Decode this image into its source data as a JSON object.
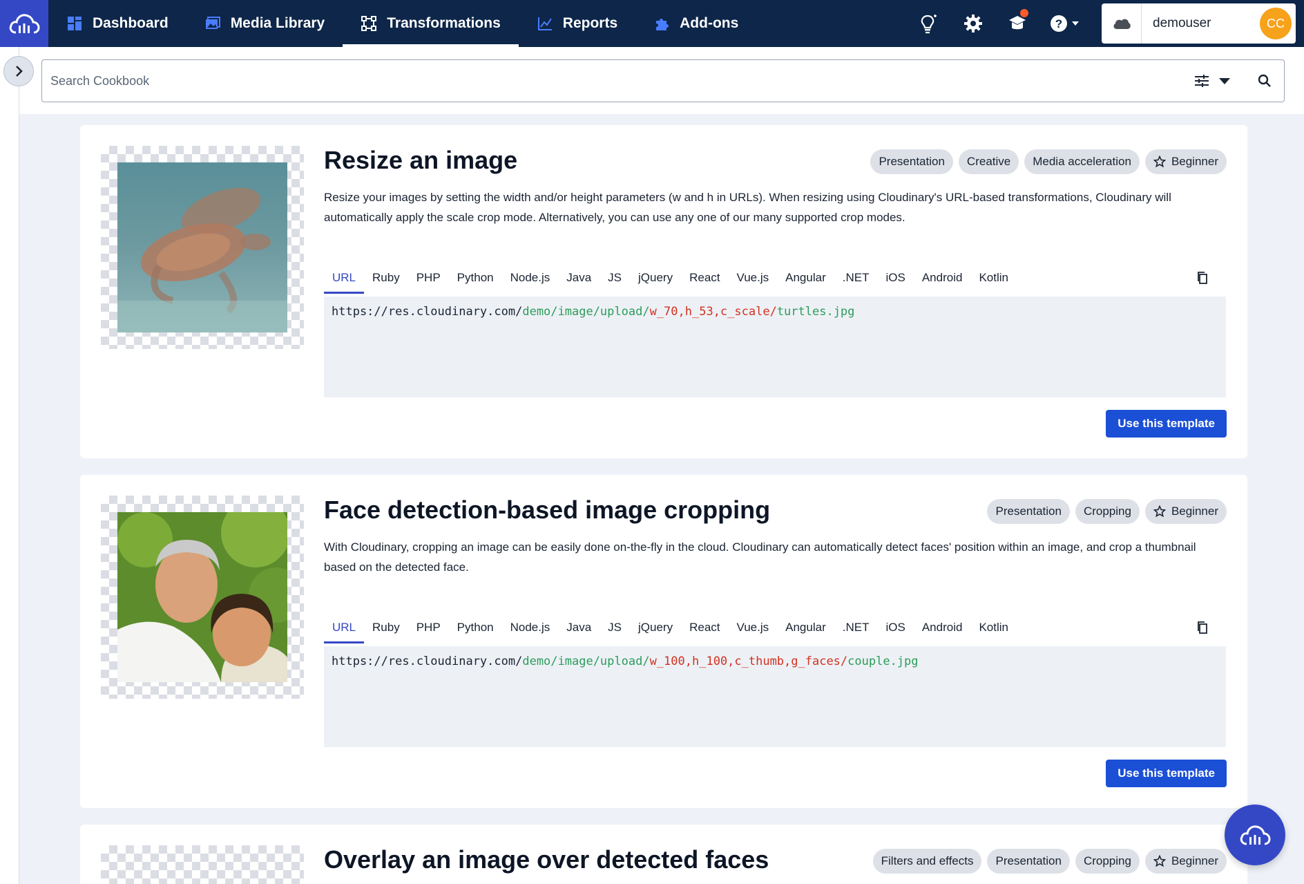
{
  "nav": {
    "items": [
      {
        "label": "Dashboard",
        "icon": "dashboard-icon"
      },
      {
        "label": "Media Library",
        "icon": "media-library-icon"
      },
      {
        "label": "Transformations",
        "icon": "transformations-icon",
        "active": true
      },
      {
        "label": "Reports",
        "icon": "reports-icon"
      },
      {
        "label": "Add-ons",
        "icon": "addons-icon"
      }
    ],
    "right_icons": [
      "lightbulb-icon",
      "gear-icon",
      "learning-icon",
      "help-icon"
    ],
    "user": {
      "name": "demouser",
      "initials": "CC"
    }
  },
  "search": {
    "placeholder": "Search Cookbook"
  },
  "cards": [
    {
      "title": "Resize an image",
      "tags": [
        "Presentation",
        "Creative",
        "Media acceleration"
      ],
      "level": "Beginner",
      "description": "Resize your images by setting the width and/or height parameters (w and h in URLs). When resizing using Cloudinary's URL-based transformations, Cloudinary will automatically apply the scale crop mode. Alternatively, you can use any one of our many supported crop modes.",
      "tabs": [
        "URL",
        "Ruby",
        "PHP",
        "Python",
        "Node.js",
        "Java",
        "JS",
        "jQuery",
        "React",
        "Vue.js",
        "Angular",
        ".NET",
        "iOS",
        "Android",
        "Kotlin"
      ],
      "active_tab": "URL",
      "url": {
        "base": "https://res.cloudinary.com/",
        "path": "demo/image/upload/",
        "transform": "w_70,h_53,c_scale/",
        "file": "turtles.jpg"
      },
      "button": "Use this template"
    },
    {
      "title": "Face detection-based image cropping",
      "tags": [
        "Presentation",
        "Cropping"
      ],
      "level": "Beginner",
      "description": "With Cloudinary, cropping an image can be easily done on-the-fly in the cloud. Cloudinary can automatically detect faces' position within an image, and crop a thumbnail based on the detected face.",
      "tabs": [
        "URL",
        "Ruby",
        "PHP",
        "Python",
        "Node.js",
        "Java",
        "JS",
        "jQuery",
        "React",
        "Vue.js",
        "Angular",
        ".NET",
        "iOS",
        "Android",
        "Kotlin"
      ],
      "active_tab": "URL",
      "url": {
        "base": "https://res.cloudinary.com/",
        "path": "demo/image/upload/",
        "transform": "w_100,h_100,c_thumb,g_faces/",
        "file": "couple.jpg"
      },
      "button": "Use this template"
    },
    {
      "title": "Overlay an image over detected faces",
      "tags": [
        "Filters and effects",
        "Presentation",
        "Cropping"
      ],
      "level": "Beginner"
    }
  ],
  "colors": {
    "nav_bg": "#0d2649",
    "brand": "#3448c5",
    "button": "#1a4fd6",
    "avatar": "#f7a21b",
    "code_green": "#2d9c59",
    "code_red": "#d3311f"
  }
}
